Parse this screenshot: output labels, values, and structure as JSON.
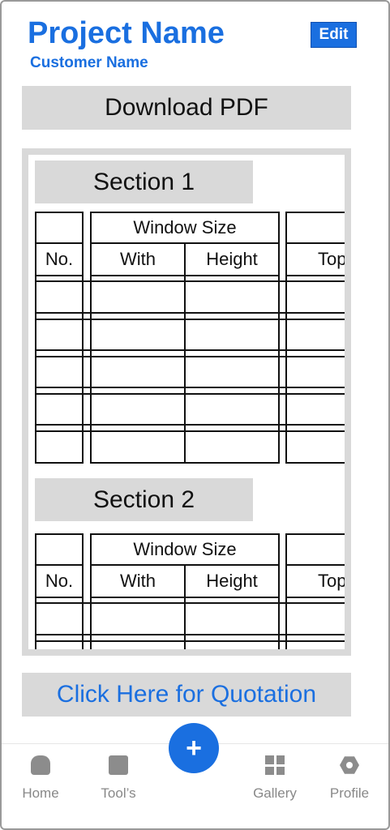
{
  "header": {
    "title": "Project Name",
    "subtitle": "Customer Name",
    "edit_label": "Edit"
  },
  "actions": {
    "download_pdf_label": "Download PDF",
    "quotation_label": "Click Here for Quotation"
  },
  "sections": [
    {
      "title": "Section 1",
      "table": {
        "group_header": "Window Size",
        "columns": [
          "No.",
          "With",
          "Height",
          "Top"
        ]
      }
    },
    {
      "title": "Section 2",
      "table": {
        "group_header": "Window Size",
        "columns": [
          "No.",
          "With",
          "Height",
          "Top"
        ]
      }
    }
  ],
  "bottom_nav": {
    "items": [
      {
        "label": "Home",
        "icon": "home-icon"
      },
      {
        "label": "Tool’s",
        "icon": "tools-icon"
      },
      {
        "label": "+",
        "icon": "plus-icon"
      },
      {
        "label": "Gallery",
        "icon": "gallery-icon"
      },
      {
        "label": "Profile",
        "icon": "profile-icon"
      }
    ]
  },
  "colors": {
    "accent": "#1a6fe0",
    "panel_gray": "#d9d9d9",
    "nav_gray": "#8c8c8c"
  }
}
